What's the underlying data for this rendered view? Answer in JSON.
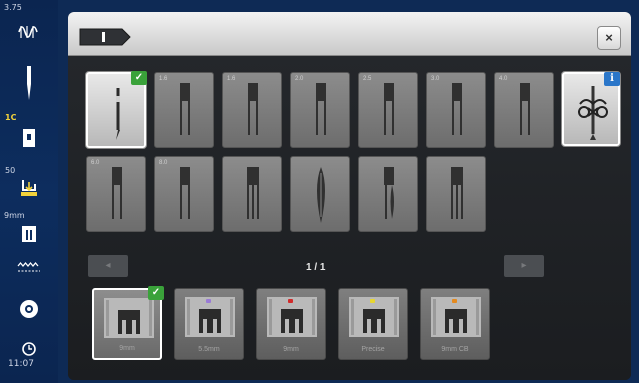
{
  "statusbar": {
    "needle_size": "3.75",
    "thread_label": "1C",
    "presser_value": "50",
    "stitch_width": "9mm",
    "clock": "11:07",
    "colors": {
      "accent": "#f2d23b"
    }
  },
  "header": {
    "close_label": "×"
  },
  "needles": [
    {
      "num": "",
      "type": "single"
    },
    {
      "num": "1.6",
      "type": "twin"
    },
    {
      "num": "1.6",
      "type": "twin"
    },
    {
      "num": "2.0",
      "type": "twin"
    },
    {
      "num": "2.5",
      "type": "twin"
    },
    {
      "num": "3.0",
      "type": "twin"
    },
    {
      "num": "4.0",
      "type": "twin"
    },
    {
      "num": "6.0",
      "type": "twin"
    },
    {
      "num": "8.0",
      "type": "twin"
    },
    {
      "num": "",
      "type": "triple"
    },
    {
      "num": "",
      "type": "wing"
    },
    {
      "num": "",
      "type": "twin-wing"
    },
    {
      "num": "",
      "type": "triple"
    }
  ],
  "pagination": {
    "indicator": "1 / 1",
    "prev_label": "◂",
    "next_label": "▸"
  },
  "feet": [
    {
      "label": "9mm",
      "dot_color": ""
    },
    {
      "label": "5.5mm",
      "dot_color": "#9a7bd6"
    },
    {
      "label": "9mm",
      "dot_color": "#d12b2b"
    },
    {
      "label": "Precise",
      "dot_color": "#e7d630"
    },
    {
      "label": "9mm CB",
      "dot_color": "#e48a1f"
    }
  ],
  "icons": {
    "threader": "needle-threader-icon",
    "close": "close-icon",
    "check": "checkmark-icon",
    "info": "info-icon"
  }
}
